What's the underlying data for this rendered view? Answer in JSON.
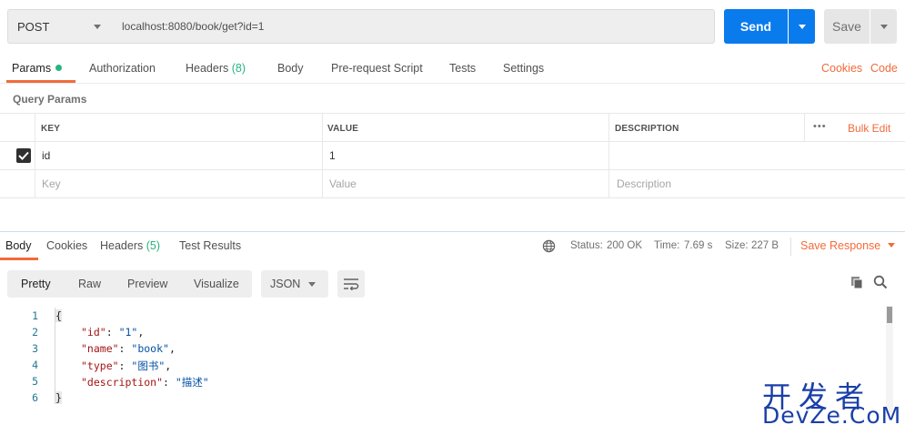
{
  "request": {
    "method": "POST",
    "url": "localhost:8080/book/get?id=1",
    "send_label": "Send",
    "save_label": "Save"
  },
  "request_tabs": {
    "params": "Params",
    "authorization": "Authorization",
    "headers": "Headers",
    "headers_count": "(8)",
    "body": "Body",
    "prerequest": "Pre-request Script",
    "tests": "Tests",
    "settings": "Settings",
    "cookies": "Cookies",
    "code": "Code"
  },
  "query_params": {
    "title": "Query Params",
    "columns": {
      "key": "KEY",
      "value": "VALUE",
      "description": "DESCRIPTION"
    },
    "bulk_edit": "Bulk Edit",
    "more": "•••",
    "rows": [
      {
        "key": "id",
        "value": "1",
        "description": ""
      }
    ],
    "placeholder": {
      "key": "Key",
      "value": "Value",
      "description": "Description"
    }
  },
  "response_tabs": {
    "body": "Body",
    "cookies": "Cookies",
    "headers": "Headers",
    "headers_count": "(5)",
    "test_results": "Test Results"
  },
  "response_meta": {
    "status_label": "Status:",
    "status_value": "200 OK",
    "time_label": "Time:",
    "time_value": "7.69 s",
    "size_label": "Size:",
    "size_value": "227 B",
    "save_response": "Save Response"
  },
  "view_modes": {
    "pretty": "Pretty",
    "raw": "Raw",
    "preview": "Preview",
    "visualize": "Visualize",
    "format": "JSON"
  },
  "code_lines": {
    "n1": "1",
    "n2": "2",
    "n3": "3",
    "n4": "4",
    "n5": "5",
    "n6": "6",
    "open": "{",
    "close": "}",
    "k1": "\"id\"",
    "v1": "\"1\"",
    "k2": "\"name\"",
    "v2": "\"book\"",
    "k3": "\"type\"",
    "v3": "\"图书\"",
    "k4": "\"description\"",
    "v4": "\"描述\""
  },
  "watermark": {
    "line1": "开发者",
    "line2": "DevZe.CoM"
  },
  "colors": {
    "accent": "#f26b3a",
    "send": "#097bed",
    "success": "#26b47f"
  }
}
